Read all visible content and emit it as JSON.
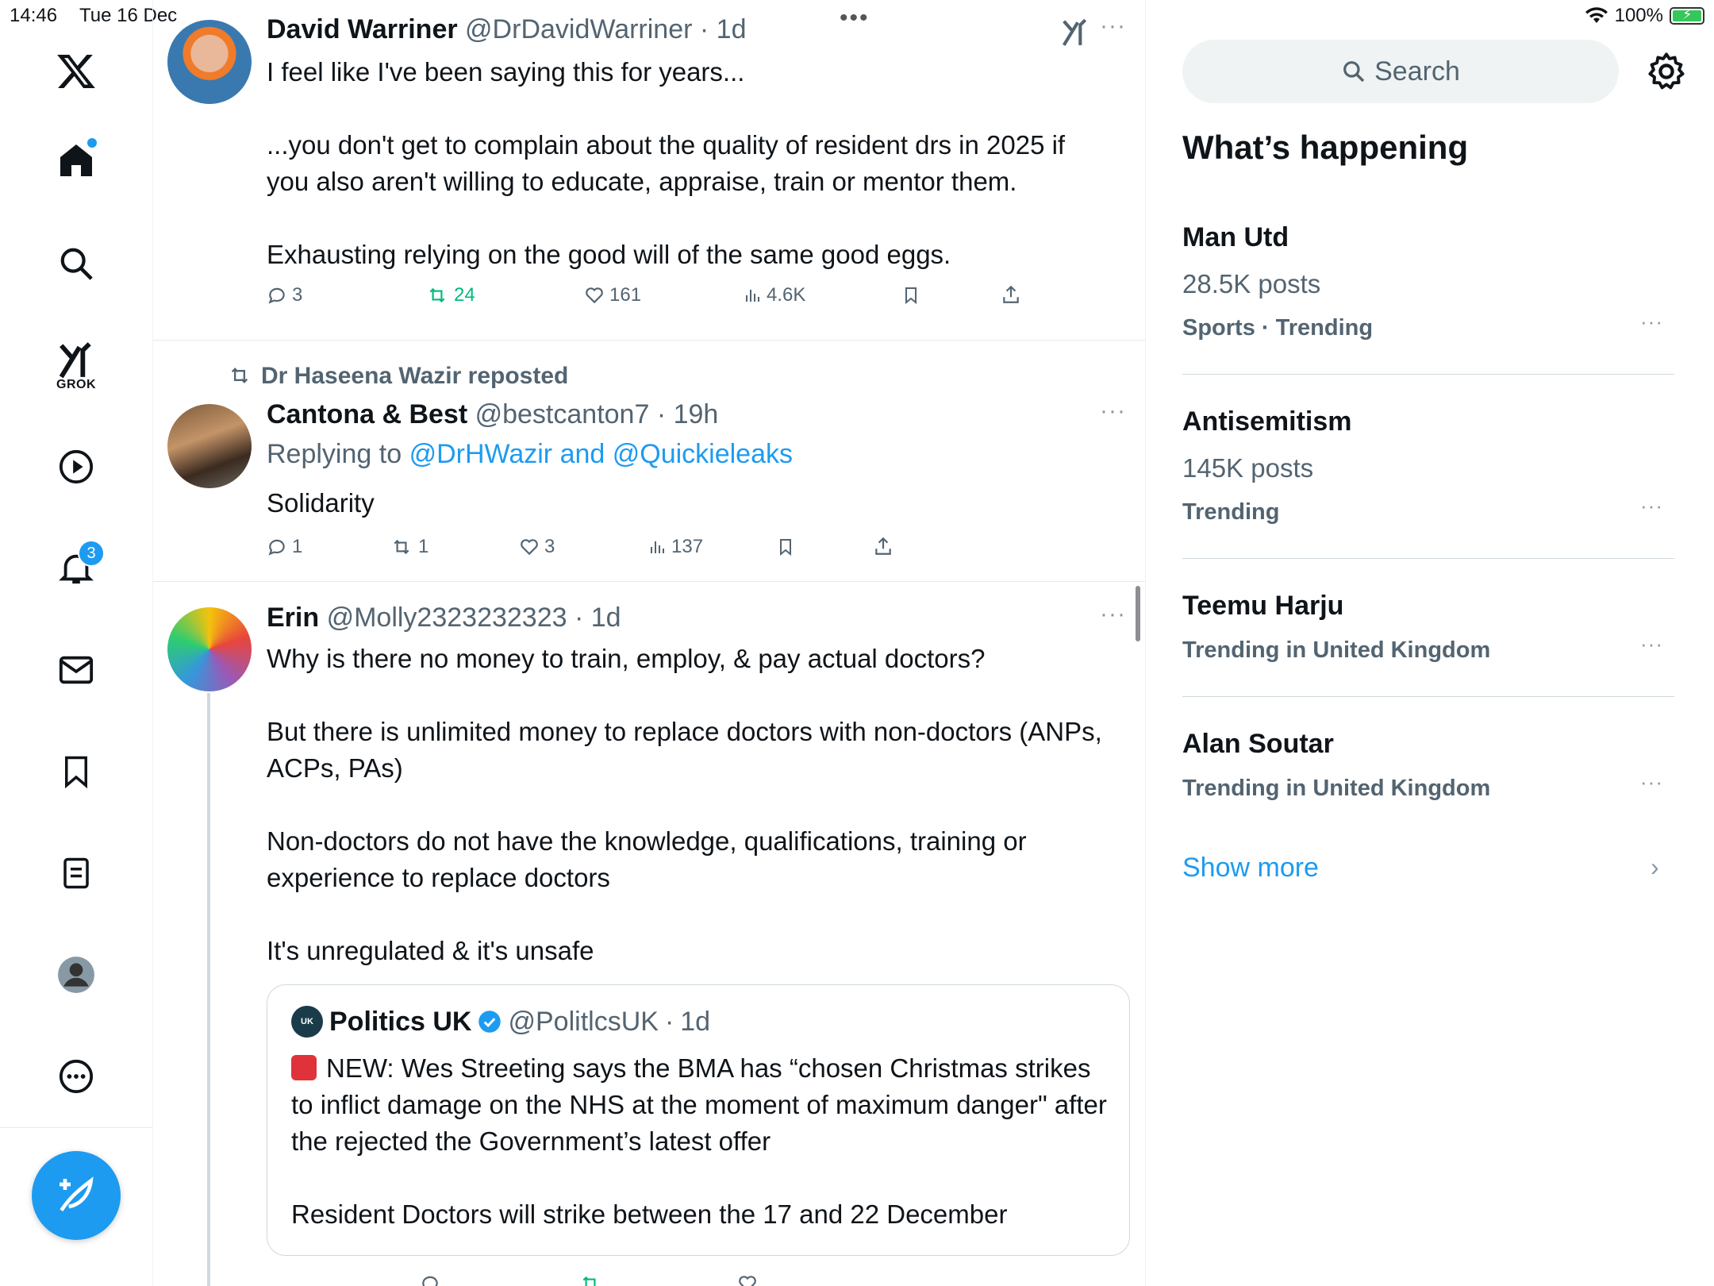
{
  "status_bar": {
    "time": "14:46",
    "date": "Tue 16 Dec",
    "battery": "100%"
  },
  "nav": {
    "grok_label": "GROK",
    "notifications_count": "3"
  },
  "feed": {
    "tweets": [
      {
        "name": "David Warriner",
        "handle": "@DrDavidWarriner",
        "time": "1d",
        "text": "I feel like I've been saying this for years...\n\n...you don't get to complain about the quality of resident drs in 2025 if you also aren't willing to educate, appraise, train or mentor them.\n\nExhausting relying on the good will of the same good eggs.",
        "replies": "3",
        "reposts": "24",
        "likes": "161",
        "views": "4.6K"
      },
      {
        "reposted_by": "Dr Haseena Wazir reposted",
        "name": "Cantona & Best",
        "handle": "@bestcanton7",
        "time": "19h",
        "replying_prefix": "Replying to",
        "replying_to": "@DrHWazir and @Quickieleaks",
        "text": "Solidarity",
        "replies": "1",
        "reposts": "1",
        "likes": "3",
        "views": "137"
      },
      {
        "name": "Erin",
        "handle": "@Molly2323232323",
        "time": "1d",
        "text": "Why is there no money to train, employ, & pay actual doctors?\n\nBut there is unlimited money to replace doctors with non-doctors (ANPs, ACPs, PAs)\n\nNon-doctors do not have the knowledge, qualifications, training or experience to replace doctors\n\nIt's unregulated & it's unsafe",
        "quote": {
          "avatar_text": "UK",
          "name": "Politics UK",
          "handle": "@PolitlcsUK",
          "time": "1d",
          "text": "NEW: Wes Streeting says the BMA has “chosen Christmas strikes to inflict damage on the NHS at the moment of maximum danger\" after the rejected the Government’s latest offer\n\nResident Doctors will strike between the 17 and 22 December"
        }
      }
    ]
  },
  "sidebar": {
    "search_placeholder": "Search",
    "title": "What’s happening",
    "trends": [
      {
        "name": "Man Utd",
        "posts": "28.5K posts",
        "meta": "Sports · Trending"
      },
      {
        "name": "Antisemitism",
        "posts": "145K posts",
        "meta": "Trending"
      },
      {
        "name": "Teemu Harju",
        "meta": "Trending in United Kingdom"
      },
      {
        "name": "Alan Soutar",
        "meta": "Trending in United Kingdom"
      }
    ],
    "show_more": "Show more"
  },
  "colors": {
    "accent": "#1d9bf0",
    "repost_green": "#00ba7c",
    "muted": "#536471"
  }
}
